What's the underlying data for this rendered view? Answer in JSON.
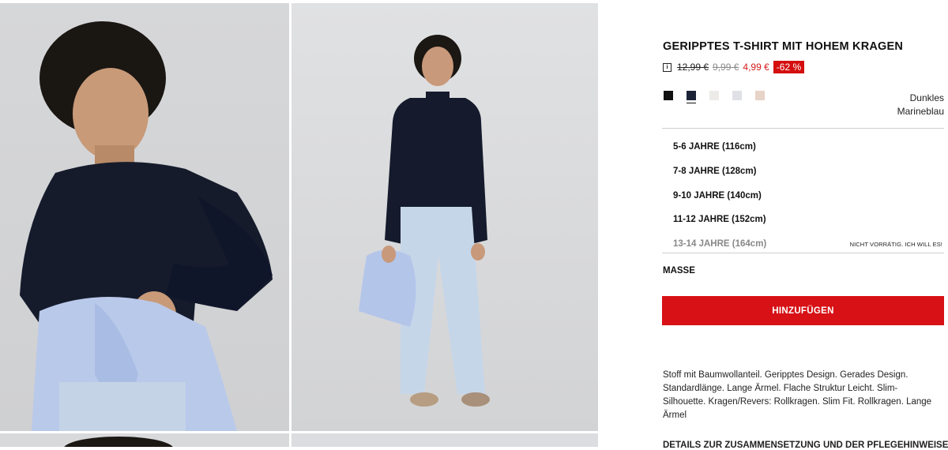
{
  "product": {
    "title": "GERIPPTES T-SHIRT MIT HOHEM KRAGEN",
    "price_old_1": "12,99 €",
    "price_old_2": "9,99 €",
    "price_current": "4,99 €",
    "discount": "-62 %",
    "info_icon": "i"
  },
  "colors": {
    "swatches": [
      {
        "name": "black",
        "hex": "#111111"
      },
      {
        "name": "navy",
        "hex": "#1c2338"
      },
      {
        "name": "off-white",
        "hex": "#ecebe8"
      },
      {
        "name": "light-grey-blue",
        "hex": "#dfe1e7"
      },
      {
        "name": "beige-pink",
        "hex": "#e8d3c8"
      }
    ],
    "selected_index": 1,
    "selected_name_line1": "Dunkles",
    "selected_name_line2": "Marineblau"
  },
  "sizes": [
    {
      "label": "5-6 JAHRE (116cm)",
      "available": true,
      "note": ""
    },
    {
      "label": "7-8 JAHRE (128cm)",
      "available": true,
      "note": ""
    },
    {
      "label": "9-10 JAHRE (140cm)",
      "available": true,
      "note": ""
    },
    {
      "label": "11-12 JAHRE (152cm)",
      "available": true,
      "note": ""
    },
    {
      "label": "13-14 JAHRE (164cm)",
      "available": false,
      "note": "NICHT VORRÄTIG. ICH WILL ES!"
    }
  ],
  "masse_label": "MASSE",
  "add_button": "HINZUFÜGEN",
  "description": "Stoff mit Baumwollanteil. Geripptes Design. Gerades Design. Standardlänge. Lange Ärmel. Flache Struktur Leicht. Slim-Silhouette. Kragen/Revers: Rollkragen. Slim Fit. Rollkragen. Lange Ärmel",
  "details_link": "DETAILS ZUR ZUSAMMENSETZUNG UND DER PFLEGEHINWEISE",
  "accent_color": "#d71116"
}
